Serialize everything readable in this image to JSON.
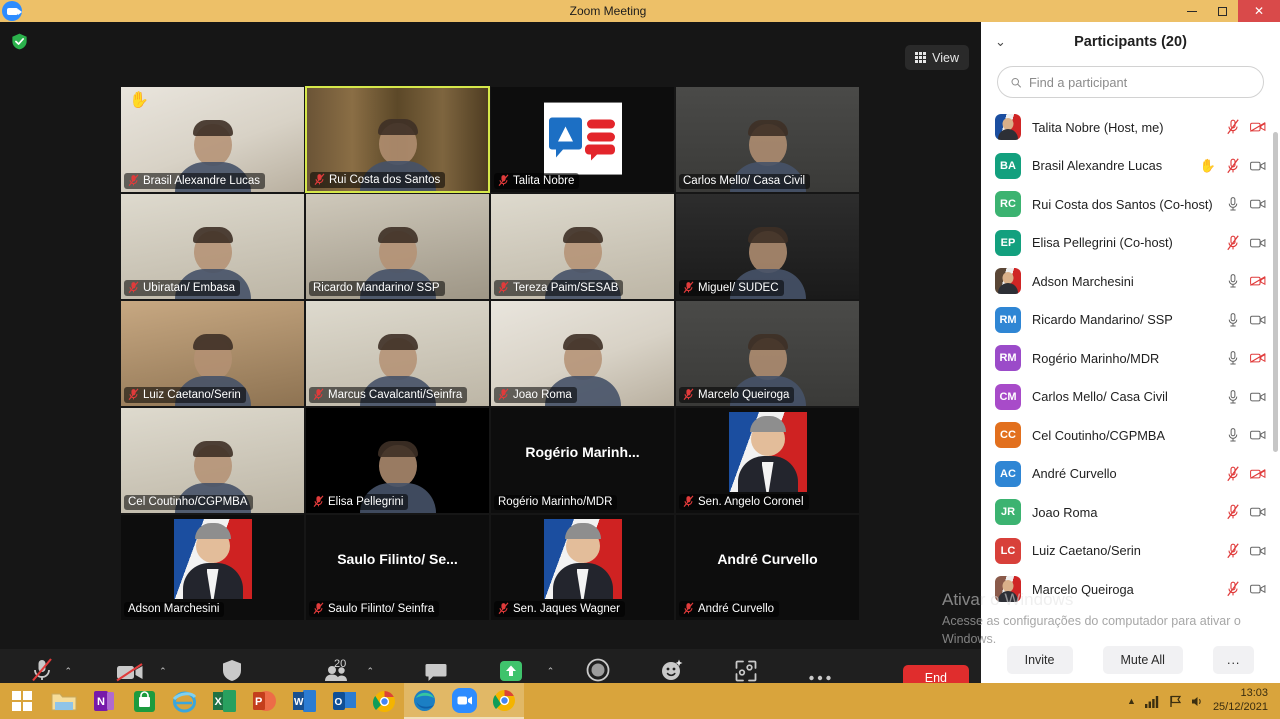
{
  "titlebar": {
    "title": "Zoom Meeting",
    "app_icon": "zoom-camera-icon",
    "minimize": "–",
    "maximize": "❐",
    "close": "✕"
  },
  "meeting": {
    "secure_icon": "shield-check-icon",
    "view_button": {
      "label": "View",
      "icon": "grid-view-icon"
    }
  },
  "tiles": [
    {
      "name": "Brasil Alexandre Lucas",
      "muted": true,
      "hand_raised": true,
      "speaking": false,
      "bg": "bg-a",
      "style": "video"
    },
    {
      "name": "Rui Costa dos Santos",
      "muted": true,
      "hand_raised": false,
      "speaking": true,
      "bg": "bg-books",
      "style": "video"
    },
    {
      "name": "Talita Nobre",
      "muted": true,
      "hand_raised": false,
      "speaking": false,
      "bg": "bg-black",
      "style": "logo"
    },
    {
      "name": "Carlos Mello/ Casa Civil",
      "muted": false,
      "hand_raised": false,
      "speaking": false,
      "bg": "bg-dark",
      "style": "video"
    },
    {
      "name": "Ubiratan/ Embasa",
      "muted": true,
      "hand_raised": false,
      "speaking": false,
      "bg": "bg-room",
      "style": "video"
    },
    {
      "name": "Ricardo Mandarino/ SSP",
      "muted": false,
      "hand_raised": false,
      "speaking": false,
      "bg": "bg-office",
      "style": "video"
    },
    {
      "name": "Tereza Paim/SESAB",
      "muted": true,
      "hand_raised": false,
      "speaking": false,
      "bg": "bg-room",
      "style": "video"
    },
    {
      "name": "Miguel/ SUDEC",
      "muted": true,
      "hand_raised": false,
      "speaking": false,
      "bg": "bg-orange",
      "style": "video"
    },
    {
      "name": "Luiz Caetano/Serin",
      "muted": true,
      "hand_raised": false,
      "speaking": false,
      "bg": "bg-warm",
      "style": "video"
    },
    {
      "name": "Marcus Cavalcanti/Seinfra",
      "muted": true,
      "hand_raised": false,
      "speaking": false,
      "bg": "bg-room",
      "style": "video"
    },
    {
      "name": "Joao Roma",
      "muted": true,
      "hand_raised": false,
      "speaking": false,
      "bg": "bg-a",
      "style": "video"
    },
    {
      "name": "Marcelo Queiroga",
      "muted": true,
      "hand_raised": false,
      "speaking": false,
      "bg": "bg-dark",
      "style": "video"
    },
    {
      "name": "Cel Coutinho/CGPMBA",
      "muted": false,
      "hand_raised": false,
      "speaking": false,
      "bg": "bg-room",
      "style": "video"
    },
    {
      "name": "Elisa Pellegrini",
      "muted": true,
      "hand_raised": false,
      "speaking": false,
      "bg": "bg-black",
      "style": "video"
    },
    {
      "name": "Rogério Marinho/MDR",
      "center_label": "Rogério  Marinh...",
      "muted": false,
      "hand_raised": false,
      "speaking": false,
      "bg": "bg-black",
      "style": "name"
    },
    {
      "name": "Sen. Angelo Coronel",
      "muted": true,
      "hand_raised": false,
      "speaking": false,
      "bg": "bg-black",
      "style": "portrait"
    },
    {
      "name": "Adson Marchesini",
      "muted": false,
      "hand_raised": false,
      "speaking": false,
      "bg": "bg-black",
      "style": "portrait"
    },
    {
      "name": "Saulo Filinto/ Seinfra",
      "center_label": "Saulo  Filinto/  Se...",
      "muted": true,
      "hand_raised": false,
      "speaking": false,
      "bg": "bg-black",
      "style": "name"
    },
    {
      "name": "Sen. Jaques Wagner",
      "muted": true,
      "hand_raised": false,
      "speaking": false,
      "bg": "bg-black",
      "style": "portrait"
    },
    {
      "name": "André Curvello",
      "center_label": "André Curvello",
      "muted": true,
      "hand_raised": false,
      "speaking": false,
      "bg": "bg-black",
      "style": "name"
    }
  ],
  "toolbar": {
    "items": [
      {
        "label": "Unmute",
        "icon": "mic-muted-icon",
        "has_caret": true,
        "green": false
      },
      {
        "label": "Start Video",
        "icon": "camera-off-icon",
        "has_caret": true,
        "green": false
      },
      {
        "label": "Security",
        "icon": "shield-icon",
        "has_caret": false,
        "green": false
      },
      {
        "label": "Participants",
        "icon": "people-icon",
        "has_caret": true,
        "green": false,
        "badge": "20"
      },
      {
        "label": "Chat",
        "icon": "chat-bubble-icon",
        "has_caret": false,
        "green": false
      },
      {
        "label": "Share Screen",
        "icon": "share-screen-icon",
        "has_caret": true,
        "green": true
      },
      {
        "label": "Record",
        "icon": "record-circle-icon",
        "has_caret": false,
        "green": false
      },
      {
        "label": "Reactions",
        "icon": "smiley-reactions-icon",
        "has_caret": false,
        "green": false
      },
      {
        "label": "Apps",
        "icon": "apps-bracket-icon",
        "has_caret": false,
        "green": false
      },
      {
        "label": "More",
        "icon": "more-dots-icon",
        "has_caret": false,
        "green": false
      }
    ],
    "end_label": "End"
  },
  "panel": {
    "title": "Participants (20)",
    "chevron_icon": "chevron-down-icon",
    "search_placeholder": "Find a participant",
    "search_value": "",
    "search_icon": "search-icon",
    "participants": [
      {
        "name": "Talita Nobre (Host, me)",
        "initials": "",
        "avatar_type": "image",
        "color": "#1b4ea0",
        "mic": "muted",
        "cam": "off"
      },
      {
        "name": "Brasil Alexandre Lucas",
        "initials": "BA",
        "avatar_type": "initials",
        "color": "#13a07e",
        "mic": "muted",
        "cam": "on",
        "hand": true
      },
      {
        "name": "Rui Costa dos Santos (Co-host)",
        "initials": "RC",
        "avatar_type": "initials",
        "color": "#3cb371",
        "mic": "unmuted",
        "cam": "on"
      },
      {
        "name": "Elisa Pellegrini (Co-host)",
        "initials": "EP",
        "avatar_type": "initials",
        "color": "#13a07e",
        "mic": "muted",
        "cam": "on"
      },
      {
        "name": "Adson Marchesini",
        "initials": "",
        "avatar_type": "image",
        "color": "#5a4636",
        "mic": "unmuted",
        "cam": "off"
      },
      {
        "name": "Ricardo Mandarino/ SSP",
        "initials": "RM",
        "avatar_type": "initials",
        "color": "#2f86d4",
        "mic": "unmuted",
        "cam": "on"
      },
      {
        "name": "Rogério Marinho/MDR",
        "initials": "RM",
        "avatar_type": "initials",
        "color": "#9b4bc9",
        "mic": "unmuted",
        "cam": "off"
      },
      {
        "name": "Carlos Mello/ Casa Civil",
        "initials": "CM",
        "avatar_type": "initials",
        "color": "#a84bc9",
        "mic": "unmuted",
        "cam": "on"
      },
      {
        "name": "Cel Coutinho/CGPMBA",
        "initials": "CC",
        "avatar_type": "initials",
        "color": "#e2701e",
        "mic": "unmuted",
        "cam": "on"
      },
      {
        "name": "André Curvello",
        "initials": "AC",
        "avatar_type": "initials",
        "color": "#2f86d4",
        "mic": "muted",
        "cam": "off"
      },
      {
        "name": "Joao Roma",
        "initials": "JR",
        "avatar_type": "initials",
        "color": "#3cb371",
        "mic": "muted",
        "cam": "on"
      },
      {
        "name": "Luiz Caetano/Serin",
        "initials": "LC",
        "avatar_type": "initials",
        "color": "#d8403a",
        "mic": "muted",
        "cam": "on"
      },
      {
        "name": "Marcelo Queiroga",
        "initials": "",
        "avatar_type": "image",
        "color": "#8a5a4a",
        "mic": "muted",
        "cam": "on"
      }
    ],
    "footer": {
      "invite": "Invite",
      "mute_all": "Mute All",
      "more": "..."
    }
  },
  "watermark": {
    "title": "Ativar o Windows",
    "subtitle": "Acesse as configurações do computador para ativar o Windows."
  },
  "taskbar": {
    "start_icon": "windows-start-icon",
    "apps": [
      {
        "name": "file-explorer-icon",
        "active": false
      },
      {
        "name": "onenote-icon",
        "active": false
      },
      {
        "name": "microsoft-store-icon",
        "active": false
      },
      {
        "name": "internet-explorer-icon",
        "active": false
      },
      {
        "name": "excel-icon",
        "active": false
      },
      {
        "name": "powerpoint-icon",
        "active": false
      },
      {
        "name": "word-icon",
        "active": false
      },
      {
        "name": "outlook-icon",
        "active": false
      },
      {
        "name": "chrome-icon",
        "active": false
      },
      {
        "name": "edge-icon",
        "active": true
      },
      {
        "name": "zoom-icon",
        "active": true
      },
      {
        "name": "chrome-window-icon",
        "active": true
      }
    ],
    "tray": {
      "show_hidden_icon": "chevron-up-icon",
      "network_icon": "signal-bars-icon",
      "flag_icon": "notification-flag-icon",
      "volume_icon": "speaker-icon",
      "time": "13:03",
      "date": "25/12/2021"
    }
  }
}
